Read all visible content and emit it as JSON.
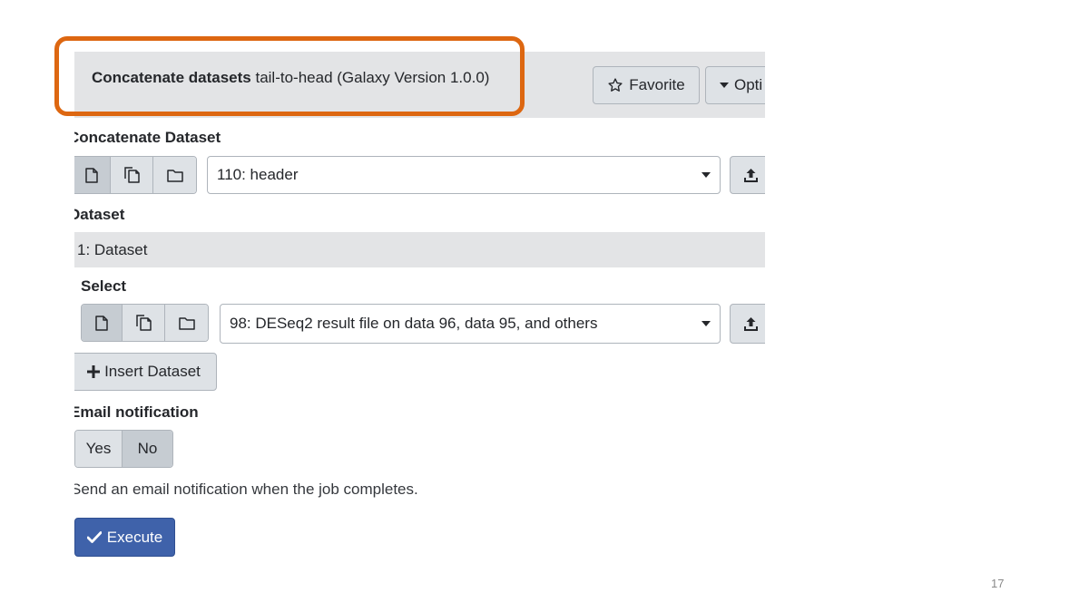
{
  "tool": {
    "name": "Concatenate datasets",
    "description": "tail-to-head (Galaxy Version 1.0.0)"
  },
  "header": {
    "favorite_label": "Favorite",
    "options_label": "Opti"
  },
  "concatenate": {
    "label": "Concatenate Dataset",
    "selected": "110: header"
  },
  "dataset_section": {
    "label": "Dataset",
    "repeat_title": "1: Dataset",
    "select_label": "Select",
    "selected": "98: DESeq2 result file on data 96, data 95, and others"
  },
  "insert_dataset_label": "Insert Dataset",
  "email": {
    "label": "Email notification",
    "yes_label": "Yes",
    "no_label": "No",
    "selected": "No",
    "help": "Send an email notification when the job completes."
  },
  "execute_label": "Execute",
  "slide_number": "17",
  "colors": {
    "highlight": "#dd6711",
    "execute": "#3f62aa",
    "header_bg": "#e3e4e6"
  }
}
